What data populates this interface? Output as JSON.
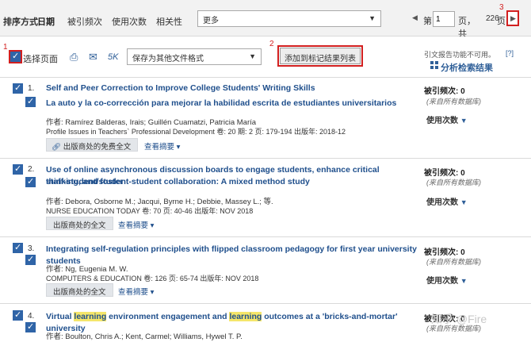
{
  "sort": {
    "label": "排序方式:",
    "active": "日期",
    "options": [
      "被引频次",
      "使用次数",
      "相关性"
    ],
    "more": "更多"
  },
  "pager": {
    "prefix": "第",
    "page": "1",
    "mid": "页，共",
    "total": "226",
    "suffix": "页"
  },
  "step_labels": [
    "1",
    "2",
    "3"
  ],
  "toolbar": {
    "select_page": "选择页面",
    "fivek": "5K",
    "save_format": "保存为其他文件格式",
    "add_marked": "添加到标记结果列表",
    "cite_note": "引文报告功能不可用。",
    "cite_help": "[?]",
    "analyze": "分析检索结果"
  },
  "records": [
    {
      "num": "1.",
      "title": "Self and Peer Correction to Improve College Students' Writing Skills",
      "subtitle": "La auto y la co-corrección para mejorar la habilidad escrita de estudiantes universitarios",
      "authors": "作者: Ramírez Balderas, Irais; Guillén Cuamatzi, Patricia María",
      "source": "Profile Issues in Teachers` Professional Development  卷: 20  期: 2  页: 179-194  出版年: 2018-12",
      "fulltext": "出版商处的免费全文",
      "abstract": "查看摘要 ▾",
      "cited": "被引频次: 0",
      "cited_src": "(来自所有数据库)",
      "usage": "使用次数"
    },
    {
      "num": "2.",
      "title_line1": "Use of online asynchronous discussion boards to engage students, enhance critical thinking, and foster",
      "title_line2": "staff-student/student-student collaboration: A mixed method study",
      "authors": "作者: Debora, Osborne M.; Jacqui, Byrne H.; Debbie, Massey L.; 等.",
      "source": "NURSE EDUCATION TODAY  卷: 70  页: 40-46  出版年: NOV 2018",
      "fulltext": "出版商处的全文",
      "abstract": "查看摘要 ▾",
      "cited": "被引频次: 0",
      "cited_src": "(来自所有数据库)",
      "usage": "使用次数"
    },
    {
      "num": "3.",
      "title": "Integrating self-regulation principles with flipped classroom pedagogy for first year university students",
      "authors": "作者: Ng, Eugenia M. W.",
      "source": "COMPUTERS & EDUCATION  卷: 126  页: 65-74  出版年: NOV 2018",
      "fulltext": "出版商处的全文",
      "abstract": "查看摘要 ▾",
      "cited": "被引频次: 0",
      "cited_src": "(来自所有数据库)",
      "usage": "使用次数"
    },
    {
      "num": "4.",
      "title_a": "Virtual ",
      "title_hl1": "learning",
      "title_b": " environment engagement and ",
      "title_hl2": "learning",
      "title_c": " outcomes at a 'bricks-and-mortar' university",
      "authors": "作者: Boulton, Chris A.; Kent, Carmel; Williams, Hywel T. P.",
      "cited": "被引频次: 0",
      "cited_src": "(来自所有数据库)"
    }
  ],
  "watermark": "知乎 @Fire"
}
